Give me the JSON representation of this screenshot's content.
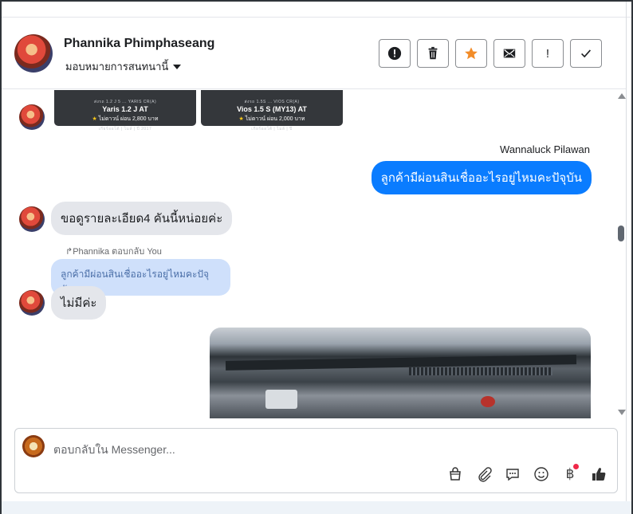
{
  "header": {
    "name": "Phannika Phimphaseang",
    "assign_label": "มอบหมายการสนทนานี้",
    "actions": [
      {
        "icon": "alert-circle-icon",
        "glyph": "!"
      },
      {
        "icon": "trash-icon"
      },
      {
        "icon": "star-icon"
      },
      {
        "icon": "envelope-icon"
      },
      {
        "icon": "exclamation-icon",
        "glyph": "!"
      },
      {
        "icon": "check-icon"
      }
    ],
    "accent_star": "#f28c28"
  },
  "messages": {
    "cards": [
      {
        "top": "ส่งรถ 1.2 J 5 ... YARIS CR(A)",
        "title": "Yaris 1.2 J AT",
        "price": "ไม่ดาวน์ ผ่อน 2,800 บาท",
        "meta": "เกียร์ออโต้ | ไมล์ | ปี 2017"
      },
      {
        "top": "ส่งรถ 1.5S ... VIOS CR(A)",
        "title": "Vios 1.5 S (MY13) AT",
        "price": "ไม่ดาวน์ ผ่อน 2,000 บาท",
        "meta": "เกียร์ออโต้ | ไมล์ | ปี"
      }
    ],
    "outgoing_sender": "Wannaluck Pilawan",
    "outgoing_text": "ลูกค้ามีผ่อนสินเชื่ออะไรอยู่ไหมคะปัจุบัน",
    "incoming_1": "ขอดูรายละเอียด4 คันนี้หน่อยค่ะ",
    "reply_meta": "↱Phannika ตอบกลับ You",
    "quoted_text": "ลูกค้ามีผ่อนสินเชื่ออะไรอยู่ไหมคะปัจุบัน",
    "incoming_2": "ไม่มีค่ะ"
  },
  "composer": {
    "placeholder": "ตอบกลับใน Messenger...",
    "tools": [
      "bag-icon",
      "paperclip-icon",
      "chat-bubble-icon",
      "smile-icon",
      "baht-icon",
      "thumbs-up-icon"
    ],
    "baht_glyph": "฿"
  },
  "colors": {
    "outgoing_bubble": "#0a7cff",
    "incoming_bubble": "#e4e6eb",
    "quoted_bubble": "#cfe0fb"
  }
}
